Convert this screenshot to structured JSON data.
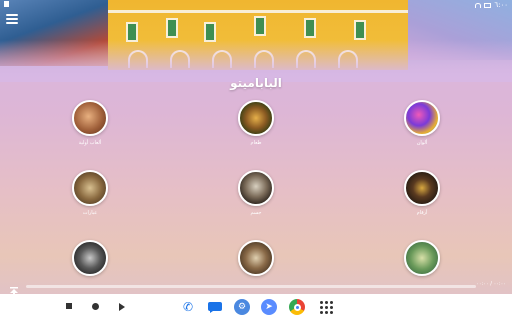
{
  "status_bar": {
    "time": "٦:٠٠"
  },
  "app": {
    "title": "الباباميتو"
  },
  "categories": [
    {
      "label": "ألوان",
      "thumb_icon": "colorful-abstract-thumbnail"
    },
    {
      "label": "طعام",
      "thumb_icon": "food-thumbnail"
    },
    {
      "label": "ألعاب أولية",
      "thumb_icon": "child-face-thumbnail"
    },
    {
      "label": "أرقام",
      "thumb_icon": "pattern-thumbnail"
    },
    {
      "label": "جسم",
      "thumb_icon": "skeleton-thumbnail"
    },
    {
      "label": "عبارات",
      "thumb_icon": "owl-figure-thumbnail"
    },
    {
      "label": "",
      "thumb_icon": "nature-thumbnail"
    },
    {
      "label": "",
      "thumb_icon": "figure-thumbnail"
    },
    {
      "label": "",
      "thumb_icon": "animal-thumbnail"
    }
  ],
  "player": {
    "time_label": "٠٠:٠٠ / ٠٠:٠٠",
    "progress": 0.0
  },
  "nav_bar": {
    "apps": [
      "phone-icon",
      "messages-icon",
      "settings-icon",
      "assistant-icon",
      "chrome-icon",
      "app-drawer-icon"
    ]
  }
}
